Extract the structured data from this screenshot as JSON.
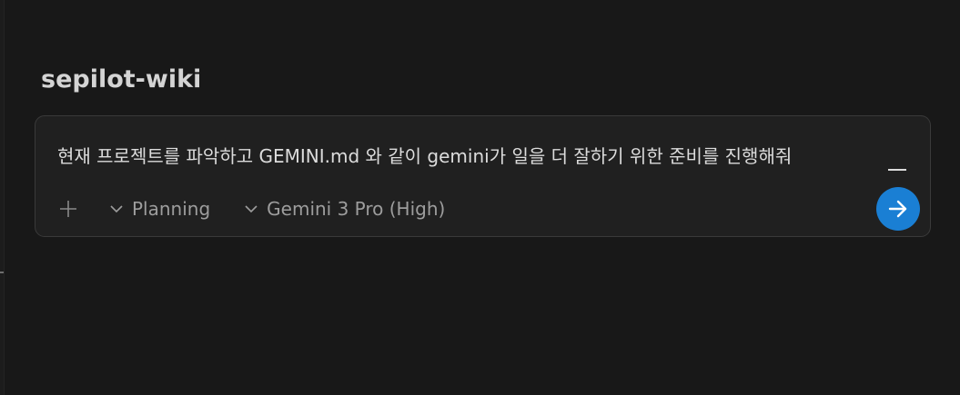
{
  "workspace": {
    "title": "sepilot-wiki"
  },
  "composer": {
    "prompt": "현재 프로젝트를 파악하고 GEMINI.md 와 같이 gemini가 일을 더 잘하기 위한 준비를 진행해줘",
    "add_icon": "plus-icon",
    "mode": {
      "label": "Planning",
      "icon": "chevron-down-icon"
    },
    "model": {
      "label": "Gemini 3 Pro (High)",
      "icon": "chevron-down-icon"
    },
    "send_icon": "arrow-right-icon"
  },
  "colors": {
    "background": "#181818",
    "composer_background": "#202020",
    "composer_border": "#3a3a3a",
    "accent": "#1a7fd4",
    "text_primary": "#dcdcdc",
    "text_muted": "#9d9d9d"
  }
}
